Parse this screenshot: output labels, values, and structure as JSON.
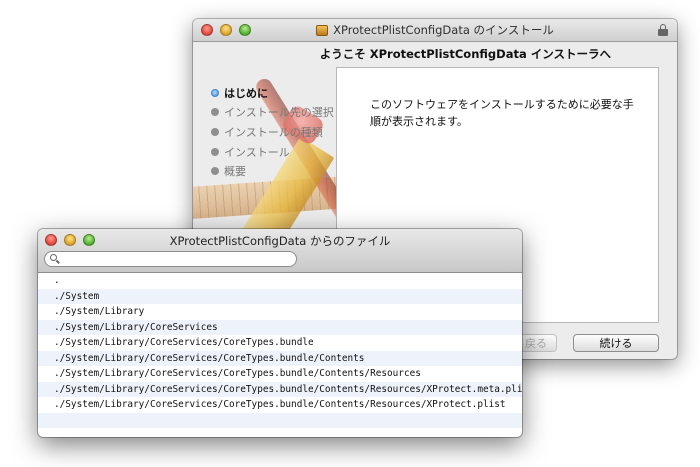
{
  "installer": {
    "title": "XProtectPlistConfigData のインストール",
    "heading": "ようこそ XProtectPlistConfigData インストーラへ",
    "steps": [
      {
        "label": "はじめに",
        "active": true
      },
      {
        "label": "インストール先の選択",
        "active": false
      },
      {
        "label": "インストールの種類",
        "active": false
      },
      {
        "label": "インストール",
        "active": false
      },
      {
        "label": "概要",
        "active": false
      }
    ],
    "content_text": "このソフトウェアをインストールするために必要な手順が表示されます。",
    "back_button": "戻る",
    "continue_button": "続ける"
  },
  "file_window": {
    "title": "XProtectPlistConfigData からのファイル",
    "search": {
      "value": "",
      "placeholder": ""
    },
    "files": [
      ".",
      "./System",
      "./System/Library",
      "./System/Library/CoreServices",
      "./System/Library/CoreServices/CoreTypes.bundle",
      "./System/Library/CoreServices/CoreTypes.bundle/Contents",
      "./System/Library/CoreServices/CoreTypes.bundle/Contents/Resources",
      "./System/Library/CoreServices/CoreTypes.bundle/Contents/Resources/XProtect.meta.plist",
      "./System/Library/CoreServices/CoreTypes.bundle/Contents/Resources/XProtect.plist",
      ""
    ]
  },
  "icons": {
    "package": "package-icon",
    "lock": "lock-icon",
    "search": "search-icon"
  },
  "colors": {
    "active_step": "#3b86d4",
    "close": "#e0443a",
    "minimize": "#dba226",
    "zoom": "#4fae2f",
    "row_stripe": "#eef3fb"
  }
}
